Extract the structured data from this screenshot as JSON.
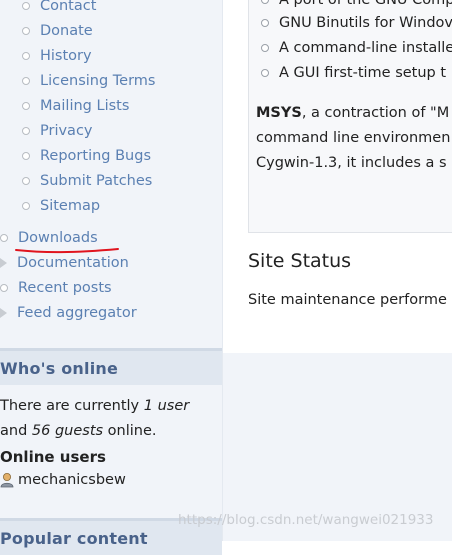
{
  "sidebar": {
    "submenu": [
      {
        "label": "Contact"
      },
      {
        "label": "Donate"
      },
      {
        "label": "History"
      },
      {
        "label": "Licensing Terms"
      },
      {
        "label": "Mailing Lists"
      },
      {
        "label": "Privacy"
      },
      {
        "label": "Reporting Bugs"
      },
      {
        "label": "Submit Patches"
      },
      {
        "label": "Sitemap"
      }
    ],
    "menu": [
      {
        "label": "Downloads"
      },
      {
        "label": "Documentation"
      },
      {
        "label": "Recent posts"
      },
      {
        "label": "Feed aggregator"
      }
    ],
    "whos_online": {
      "title": "Who's online",
      "line1_prefix": "There are currently ",
      "users_count": "1 user",
      "line2_prefix": "and ",
      "guests_count": "56 guests",
      "line2_suffix": " online.",
      "online_users_title": "Online users",
      "username": "mechanicsbew"
    },
    "popular": {
      "title": "Popular content"
    }
  },
  "main": {
    "bullets": [
      {
        "label": "A port of the GNU Comp"
      },
      {
        "label": "GNU Binutils for Windov"
      },
      {
        "label": "A command-line installe"
      },
      {
        "label": "A GUI first-time setup t"
      }
    ],
    "msys_bold": "MSYS",
    "msys_line1_rest": ", a contraction of \"M",
    "msys_line2": "command line environmen",
    "msys_line3": "Cygwin-1.3, it includes a s",
    "site_status_title": "Site Status",
    "site_status_text": "Site maintenance performe"
  },
  "watermark": "https://blog.csdn.net/wangwei021933",
  "colors": {
    "link": "#5b80b2",
    "sidebar_bg": "#f1f4f9",
    "block_header_bg": "#e0e7f0",
    "annotation_red": "#e0141e"
  }
}
